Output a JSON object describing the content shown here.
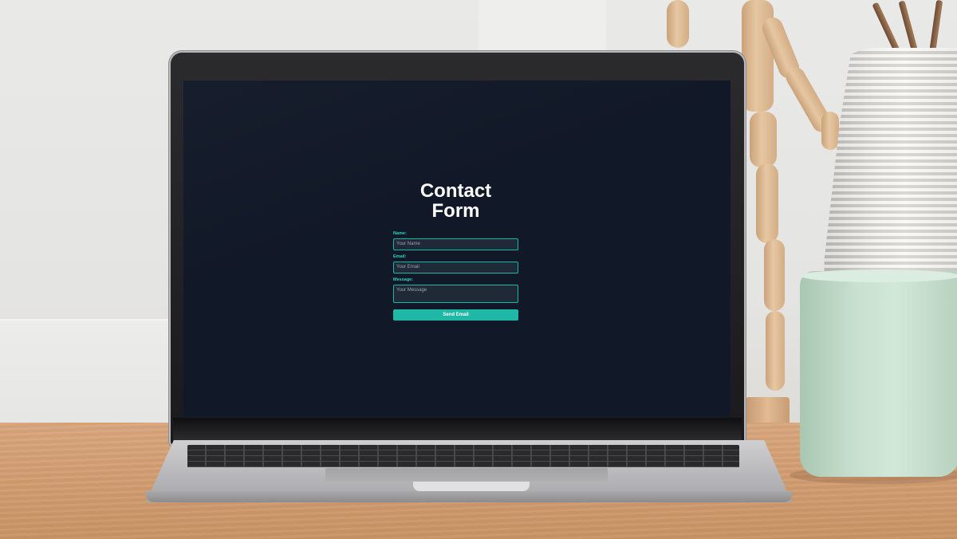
{
  "contact_form": {
    "title_line1": "Contact",
    "title_line2": "Form",
    "name_label": "Name:",
    "name_placeholder": "Your Name",
    "email_label": "Email:",
    "email_placeholder": "Your Email",
    "message_label": "Message:",
    "message_placeholder": "Your Message",
    "send_label": "Send Email"
  },
  "colors": {
    "page_background": "#111827",
    "accent": "#14b8a6",
    "label": "#2dd4bf",
    "input_background": "#1f2937",
    "title": "#ffffff"
  }
}
